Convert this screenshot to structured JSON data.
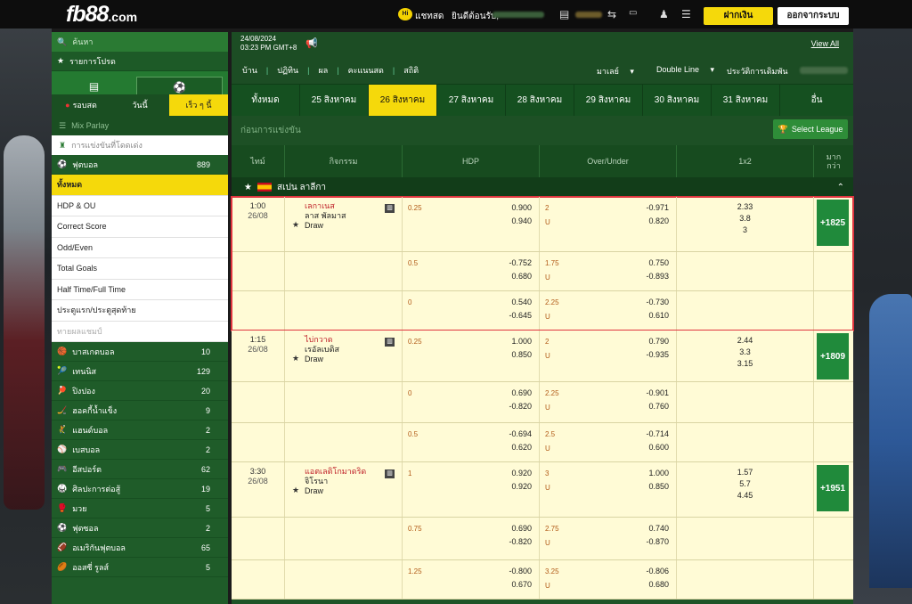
{
  "topbar": {
    "logo": "fb88",
    "logo_suffix": ".com",
    "hi": "Hi",
    "live_label": "แชทสด",
    "welcome": "ยินดีต้อนรับ,",
    "deposit": "ฝากเงิน",
    "logout": "ออกจากระบบ"
  },
  "sidebar": {
    "search": "ค้นหา",
    "favorites": "รายการโปรด",
    "tabs": [
      "รอบสด",
      "วันนี้",
      "เร็ว ๆ นี้"
    ],
    "mix_parlay": "Mix Parlay",
    "fav_search": "การแข่งขันที่โดดเด่ง",
    "football": {
      "label": "ฟุตบอล",
      "count": "889"
    },
    "subs": [
      "ทั้งหมด",
      "HDP & OU",
      "Correct Score",
      "Odd/Even",
      "Total Goals",
      "Half Time/Full Time",
      "ประตูแรก/ประตูสุดท้าย",
      "ทายผลแชมป์"
    ],
    "cats": [
      {
        "label": "บาสเกตบอล",
        "count": "10"
      },
      {
        "label": "เทนนิส",
        "count": "129"
      },
      {
        "label": "ปิงปอง",
        "count": "20"
      },
      {
        "label": "ฮอคกี้น้ำแข็ง",
        "count": "9"
      },
      {
        "label": "แฮนด์บอล",
        "count": "2"
      },
      {
        "label": "เบสบอล",
        "count": "2"
      },
      {
        "label": "อีสปอร์ต",
        "count": "62"
      },
      {
        "label": "ศิลปะการต่อสู้",
        "count": "19"
      },
      {
        "label": "มวย",
        "count": "5"
      },
      {
        "label": "ฟุตซอล",
        "count": "2"
      },
      {
        "label": "อเมริกันฟุตบอล",
        "count": "65"
      },
      {
        "label": "ออสซี่ รูลส์",
        "count": "5"
      }
    ]
  },
  "main": {
    "date": "24/08/2024",
    "time": "03:23 PM GMT+8",
    "view_all": "View All",
    "nav": [
      "บ้าน",
      "ปฏิทิน",
      "ผล",
      "คะแนนสด",
      "สถิติ"
    ],
    "market": "มาเลย์",
    "line": "Double Line",
    "history": "ประวัติการเดิมพัน",
    "dates": [
      "ทั้งหมด",
      "25 สิงหาคม",
      "26 สิงหาคม",
      "27 สิงหาคม",
      "28 สิงหาคม",
      "29 สิงหาคม",
      "30 สิงหาคม",
      "31 สิงหาคม",
      "อื่น"
    ],
    "pre_match": "ก่อนการแข่งขัน",
    "select_league": "Select League",
    "headers": {
      "time": "ไทม์",
      "event": "กิจกรรม",
      "hdp": "HDP",
      "ou": "Over/Under",
      "x12": "1x2",
      "more": "มาก กว่า"
    },
    "league": "สเปน ลาลีกา",
    "ou_under": "U",
    "matches": [
      {
        "time": "1:00",
        "date": "26/08",
        "home": "เลกาเนส",
        "away": "ลาส พัลมาส",
        "draw": "Draw",
        "more": "+1825",
        "x12": [
          "2.33",
          "3.8",
          "3"
        ],
        "lines": [
          {
            "hdp": "0.25",
            "hdp1": "0.900",
            "hdp2": "0.940",
            "ou": "2",
            "ou1": "-0.971",
            "ou2": "0.820"
          },
          {
            "hdp": "0.5",
            "hdp1": "-0.752",
            "hdp2": "0.680",
            "ou": "1.75",
            "ou1": "0.750",
            "ou2": "-0.893"
          },
          {
            "hdp": "0",
            "hdp1": "0.540",
            "hdp2": "-0.645",
            "ou": "2.25",
            "ou1": "-0.730",
            "ou2": "0.610"
          }
        ]
      },
      {
        "time": "1:15",
        "date": "26/08",
        "home": "ไบ่กวาด",
        "away": "เรอัลเบติส",
        "draw": "Draw",
        "more": "+1809",
        "x12": [
          "2.44",
          "3.3",
          "3.15"
        ],
        "lines": [
          {
            "hdp": "0.25",
            "hdp1": "1.000",
            "hdp2": "0.850",
            "ou": "2",
            "ou1": "0.790",
            "ou2": "-0.935"
          },
          {
            "hdp": "0",
            "hdp1": "0.690",
            "hdp2": "-0.820",
            "ou": "2.25",
            "ou1": "-0.901",
            "ou2": "0.760"
          },
          {
            "hdp": "0.5",
            "hdp1": "-0.694",
            "hdp2": "0.620",
            "ou": "2.5",
            "ou1": "-0.714",
            "ou2": "0.600"
          }
        ]
      },
      {
        "time": "3:30",
        "date": "26/08",
        "home": "แอตเลติโกมาดริด",
        "away": "จิโรนา",
        "draw": "Draw",
        "more": "+1951",
        "x12": [
          "1.57",
          "5.7",
          "4.45"
        ],
        "lines": [
          {
            "hdp": "1",
            "hdp1": "0.920",
            "hdp2": "0.920",
            "ou": "3",
            "ou1": "1.000",
            "ou2": "0.850"
          },
          {
            "hdp": "0.75",
            "hdp1": "0.690",
            "hdp2": "-0.820",
            "ou": "2.75",
            "ou1": "0.740",
            "ou2": "-0.870"
          },
          {
            "hdp": "1.25",
            "hdp1": "-0.800",
            "hdp2": "0.670",
            "ou": "3.25",
            "ou1": "-0.806",
            "ou2": "0.680"
          }
        ]
      }
    ]
  }
}
